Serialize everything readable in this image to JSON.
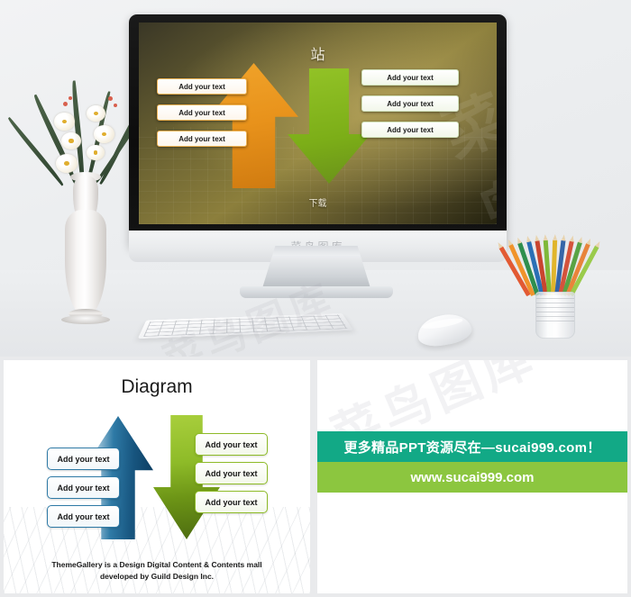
{
  "photo_mockup": {
    "watermark_screen": "菜鸟图库",
    "watermark_desk": "菜鸟图库",
    "monitor_chin_label": "菜鸟图库",
    "slide": {
      "title": "站",
      "footer": "下载",
      "left_boxes": [
        "Add your text",
        "Add your text",
        "Add your text"
      ],
      "right_boxes": [
        "Add your text",
        "Add your text",
        "Add your text"
      ],
      "up_arrow_color": "#e8921b",
      "down_arrow_color": "#7cae18"
    },
    "objects": {
      "vase": "white-vase-with-white-orchids",
      "keyboard": "wireless-keyboard",
      "mouse": "wireless-mouse",
      "pencil_cup": "colored-pencils-in-glass"
    },
    "pencil_colors": [
      "#e25a33",
      "#f0932b",
      "#2f8f4e",
      "#2a6fb5",
      "#c9452f",
      "#7fb93a",
      "#e0b52c",
      "#3f7fbf",
      "#d4533c",
      "#58a345",
      "#e8843b",
      "#3566a8",
      "#9acb4b",
      "#cf4a36"
    ]
  },
  "panel_left": {
    "title": "Diagram",
    "up_arrow_boxes": [
      "Add your text",
      "Add your text",
      "Add your text"
    ],
    "down_arrow_boxes": [
      "Add your text",
      "Add your text",
      "Add your text"
    ],
    "caption_line1": "ThemeGallery is a Design Digital Content & Contents mall",
    "caption_line2": "developed by Guild Design Inc.",
    "up_arrow_color": "#17557f",
    "down_arrow_color": "#8ebb28"
  },
  "panel_right": {
    "watermark": "菜鸟图库",
    "banner_top_text": "更多精品PPT资源尽在—sucai999.com！",
    "banner_bottom_text": "www.sucai999.com",
    "banner_top_color": "#12a986",
    "banner_bottom_color": "#8cc63f"
  }
}
